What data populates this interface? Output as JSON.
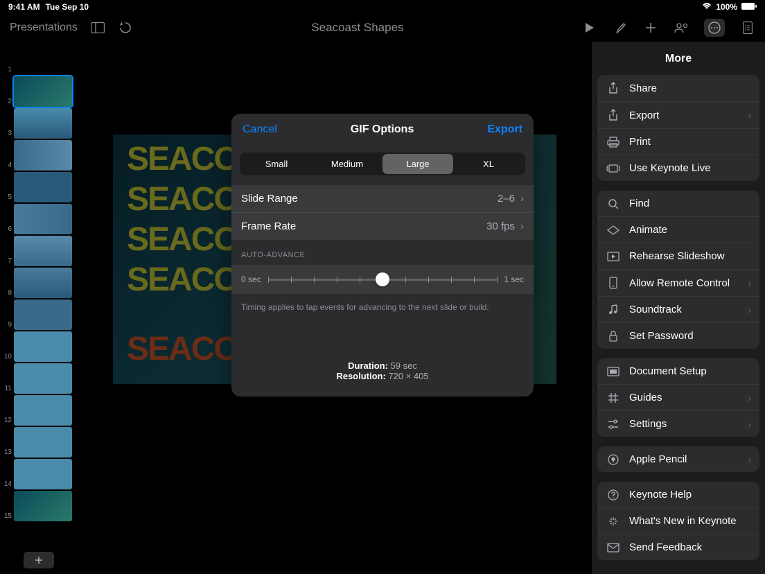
{
  "status": {
    "time": "9:41 AM",
    "date": "Tue Sep 10",
    "battery": "100%"
  },
  "toolbar": {
    "back": "Presentations",
    "title": "Seacoast Shapes"
  },
  "navigator": {
    "slides": [
      1,
      2,
      3,
      4,
      5,
      6,
      7,
      8,
      9,
      10,
      11,
      12,
      13,
      14,
      15
    ],
    "selected": 2
  },
  "preview": {
    "lines": [
      "SEACOAST",
      "SEACOAST",
      "SEACOAST",
      "SEACOAST",
      "SEACOAST"
    ]
  },
  "modal": {
    "cancel": "Cancel",
    "title": "GIF Options",
    "export": "Export",
    "sizes": [
      "Small",
      "Medium",
      "Large",
      "XL"
    ],
    "size_active": 2,
    "rows": {
      "slide_range": {
        "label": "Slide Range",
        "value": "2–6"
      },
      "frame_rate": {
        "label": "Frame Rate",
        "value": "30 fps"
      }
    },
    "auto_advance": {
      "header": "AUTO-ADVANCE",
      "min": "0 sec",
      "max": "1 sec",
      "position_pct": 50
    },
    "help": "Timing applies to tap events for advancing to the next slide or build.",
    "duration_label": "Duration:",
    "duration_value": "59 sec",
    "resolution_label": "Resolution:",
    "resolution_value": "720 × 405"
  },
  "more": {
    "title": "More",
    "groups": [
      [
        {
          "icon": "share",
          "label": "Share",
          "chev": false
        },
        {
          "icon": "export",
          "label": "Export",
          "chev": true
        },
        {
          "icon": "print",
          "label": "Print",
          "chev": false
        },
        {
          "icon": "live",
          "label": "Use Keynote Live",
          "chev": false
        }
      ],
      [
        {
          "icon": "find",
          "label": "Find",
          "chev": false
        },
        {
          "icon": "animate",
          "label": "Animate",
          "chev": false
        },
        {
          "icon": "rehearse",
          "label": "Rehearse Slideshow",
          "chev": false
        },
        {
          "icon": "remote",
          "label": "Allow Remote Control",
          "chev": true
        },
        {
          "icon": "soundtrack",
          "label": "Soundtrack",
          "chev": true
        },
        {
          "icon": "password",
          "label": "Set Password",
          "chev": false
        }
      ],
      [
        {
          "icon": "docsetup",
          "label": "Document Setup",
          "chev": false
        },
        {
          "icon": "guides",
          "label": "Guides",
          "chev": true
        },
        {
          "icon": "settings",
          "label": "Settings",
          "chev": true
        }
      ],
      [
        {
          "icon": "pencil",
          "label": "Apple Pencil",
          "chev": true
        }
      ],
      [
        {
          "icon": "help",
          "label": "Keynote Help",
          "chev": false
        },
        {
          "icon": "new",
          "label": "What's New in Keynote",
          "chev": false
        },
        {
          "icon": "feedback",
          "label": "Send Feedback",
          "chev": false
        }
      ]
    ]
  }
}
